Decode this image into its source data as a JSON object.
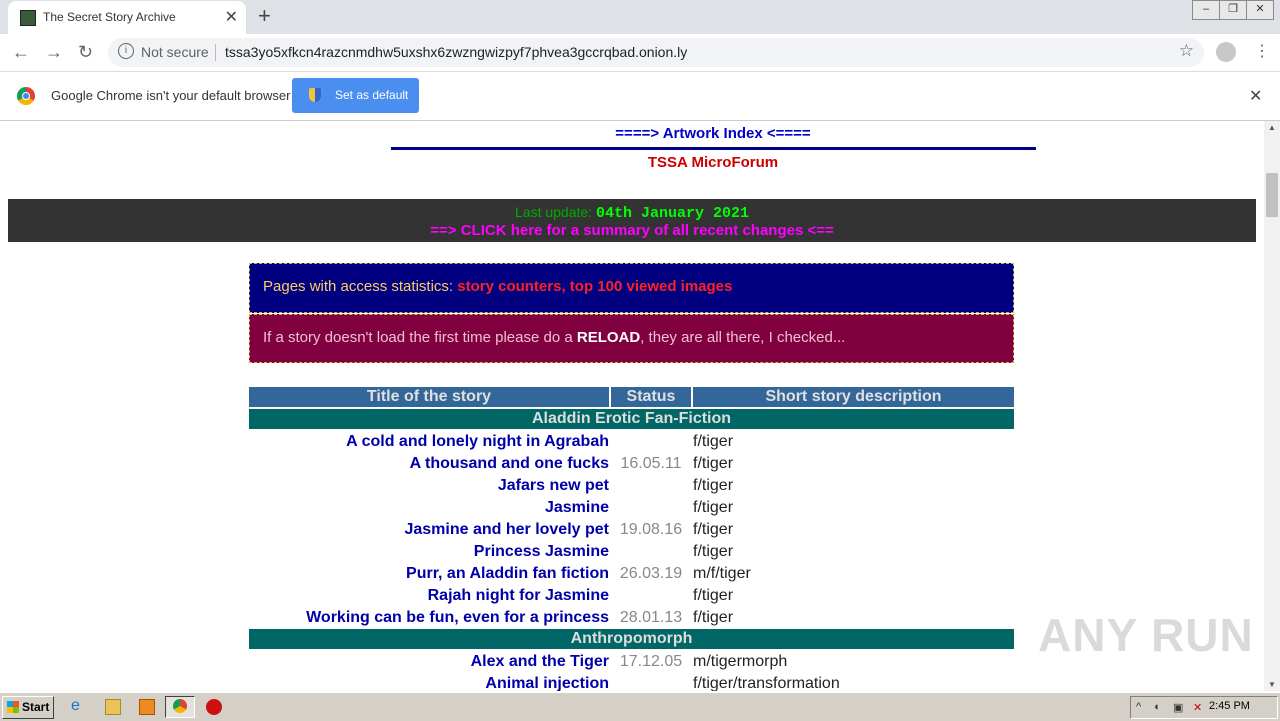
{
  "browser": {
    "tab_title": "The Secret Story Archive",
    "not_secure": "Not secure",
    "url": "tssa3yo5xfkcn4razcnmdhw5uxshx6zwzngwizpyf7phvea3gccrqbad.onion.ly",
    "infobar_text": "Google Chrome isn't your default browser",
    "set_default_label": "Set as default"
  },
  "page": {
    "artwork_index": "====> Artwork Index <====",
    "forum": "TSSA MicroForum",
    "last_update_label": "Last update:",
    "last_update_date": "04th January 2021",
    "click_here": "==> CLICK here for a summary of all recent changes <==",
    "stats_prefix": "Pages with access statistics:",
    "stats_link1": "story counters",
    "stats_sep": ",",
    "stats_link2": "top 100 viewed images",
    "reload_prefix": "If a story doesn't load the first time please do a",
    "reload_bold": "RELOAD",
    "reload_suffix": ", they are all there, I checked..."
  },
  "table": {
    "headers": [
      "Title of the story",
      "Status",
      "Short story description"
    ],
    "categories": [
      {
        "name": "Aladdin Erotic Fan-Fiction",
        "rows": [
          {
            "title": "A cold and lonely night in Agrabah",
            "status": "",
            "desc": "f/tiger"
          },
          {
            "title": "A thousand and one fucks",
            "status": "16.05.11",
            "desc": "f/tiger"
          },
          {
            "title": "Jafars new pet",
            "status": "",
            "desc": "f/tiger"
          },
          {
            "title": "Jasmine",
            "status": "",
            "desc": "f/tiger"
          },
          {
            "title": "Jasmine and her lovely pet",
            "status": "19.08.16",
            "desc": "f/tiger"
          },
          {
            "title": "Princess Jasmine",
            "status": "",
            "desc": "f/tiger"
          },
          {
            "title": "Purr, an Aladdin fan fiction",
            "status": "26.03.19",
            "desc": "m/f/tiger"
          },
          {
            "title": "Rajah night for Jasmine",
            "status": "",
            "desc": "f/tiger"
          },
          {
            "title": "Working can be fun, even for a princess",
            "status": "28.01.13",
            "desc": "f/tiger"
          }
        ]
      },
      {
        "name": "Anthropomorph",
        "rows": [
          {
            "title": "Alex and the Tiger",
            "status": "17.12.05",
            "desc": "m/tigermorph"
          },
          {
            "title": "Animal injection",
            "status": "",
            "desc": "f/tiger/transformation"
          }
        ]
      }
    ]
  },
  "watermark": "ANY RUN",
  "taskbar": {
    "start_label": "Start",
    "clock": "2:45 PM"
  }
}
